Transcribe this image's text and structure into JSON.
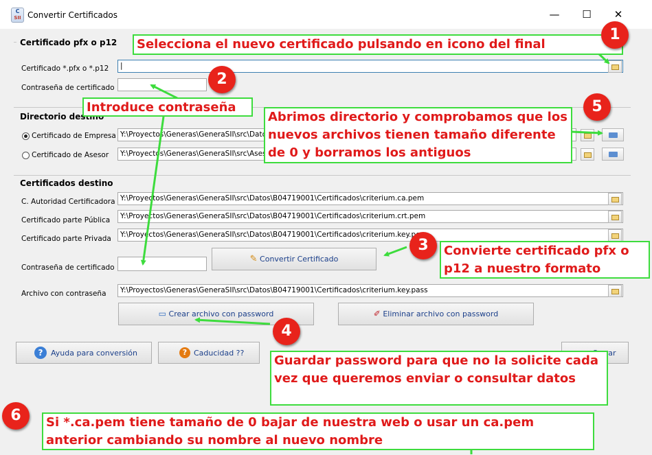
{
  "window": {
    "app_icon": {
      "letter": "C",
      "sub": "SII"
    },
    "title": "Convertir Certificados",
    "minimize": "—",
    "maximize": "☐",
    "close": "✕"
  },
  "certificado": {
    "section_title": "Certificado pfx o p12",
    "file_label": "Certificado *.pfx o *.p12",
    "file_value": "|",
    "password_label": "Contraseña de certificado"
  },
  "directorio": {
    "section_title": "Directorio destino",
    "empresa_label": "Certificado de Empresa",
    "empresa_path": "Y:\\Proyectos\\Generas\\GeneraSII\\src\\Datos\\B04719001\\Certificados",
    "asesor_label": "Certificado de Asesor",
    "asesor_path": "Y:\\Proyectos\\Generas\\GeneraSII\\src\\Asesor\\Certificados"
  },
  "destino": {
    "section_title": "Certificados destino",
    "ca_label": "C. Autoridad Certificadora",
    "ca_value": "Y:\\Proyectos\\Generas\\GeneraSII\\src\\Datos\\B04719001\\Certificados\\criterium.ca.pem",
    "publica_label": "Certificado parte Pública",
    "publica_value": "Y:\\Proyectos\\Generas\\GeneraSII\\src\\Datos\\B04719001\\Certificados\\criterium.crt.pem",
    "privada_label": "Certificado parte Privada",
    "privada_value": "Y:\\Proyectos\\Generas\\GeneraSII\\src\\Datos\\B04719001\\Certificados\\criterium.key.pem",
    "password_label": "Contraseña de certificado",
    "convert_button": "Convertir Certificado",
    "pass_file_label": "Archivo con contraseña",
    "pass_file_value": "Y:\\Proyectos\\Generas\\GeneraSII\\src\\Datos\\B04719001\\Certificados\\criterium.key.pass",
    "create_button": "Crear archivo con password",
    "delete_button": "Eliminar archivo con password"
  },
  "footer": {
    "help_button": "Ayuda para conversión",
    "caducidad_button": "Caducidad ??",
    "cerrar_button": "Cerrar"
  },
  "annotations": {
    "callout1": "Selecciona el nuevo certificado pulsando en icono del final",
    "callout2": "Introduce contraseña",
    "callout3": "Convierte certificado pfx o p12 a nuestro formato",
    "callout4": "Guardar password para que no la solicite cada vez que queremos enviar o consultar datos",
    "callout5": "Abrimos directorio y comprobamos que los nuevos archivos tienen tamaño diferente de 0 y borramos los antiguos",
    "callout6": "Si *.ca.pem tiene tamaño de 0 bajar de nuestra web o usar un ca.pem anterior cambiando su nombre al nuevo nombre",
    "badges": [
      "1",
      "2",
      "3",
      "4",
      "5",
      "6"
    ]
  },
  "colors": {
    "callout_border": "#3ddc3d",
    "callout_text": "#e01a1a",
    "badge": "#e8231b",
    "arrow": "#3ddc3d"
  }
}
